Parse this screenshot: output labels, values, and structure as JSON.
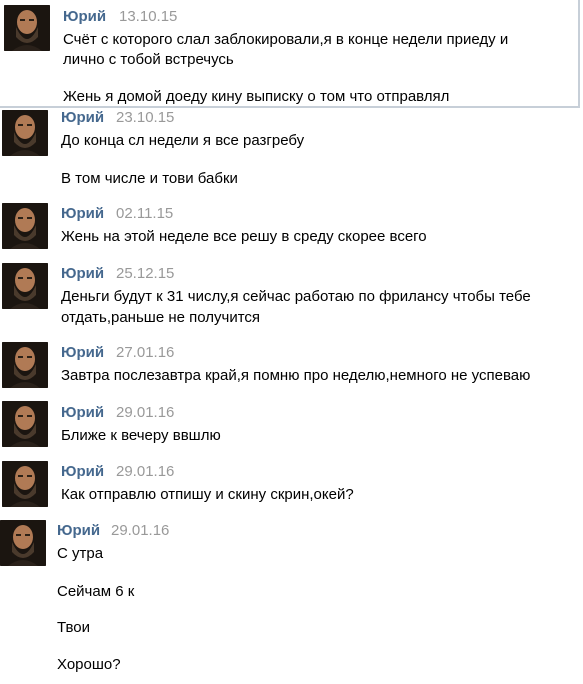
{
  "messages": [
    {
      "author": "Юрий",
      "date": "13.10.15",
      "lines": [
        "Счёт с которого слал заблокировали,я в конце недели приеду и",
        "лично с тобой встречусь",
        "Жень я домой доеду кину выписку о том что отправлял"
      ]
    },
    {
      "author": "Юрий",
      "date": "23.10.15",
      "lines": [
        "До конца сл недели я все разгребу",
        "В том числе и тови бабки"
      ]
    },
    {
      "author": "Юрий",
      "date": "02.11.15",
      "lines": [
        "Жень на этой неделе все решу в среду скорее всего"
      ]
    },
    {
      "author": "Юрий",
      "date": "25.12.15",
      "lines": [
        "Деньги будут к 31 числу,я сейчас работаю по фрилансу чтобы тебе",
        "отдать,раньше не получится"
      ]
    },
    {
      "author": "Юрий",
      "date": "27.01.16",
      "lines": [
        "Завтра послезавтра край,я помню про неделю,немного не успеваю"
      ]
    },
    {
      "author": "Юрий",
      "date": "29.01.16",
      "lines": [
        "Ближе к вечеру ввшлю"
      ]
    },
    {
      "author": "Юрий",
      "date": "29.01.16",
      "lines": [
        "Как отправлю отпишу и скину скрин,окей?"
      ]
    },
    {
      "author": "Юрий",
      "date": "29.01.16",
      "lines": [
        "С утра",
        "Сейчам 6 к",
        "Твои",
        "Хорошо?"
      ]
    }
  ],
  "colors": {
    "author": "#45688e",
    "date": "#999999",
    "text": "#000000",
    "avatar_bg": "#1b1510"
  },
  "icons": {
    "avatar": "bearded-man-avatar"
  }
}
